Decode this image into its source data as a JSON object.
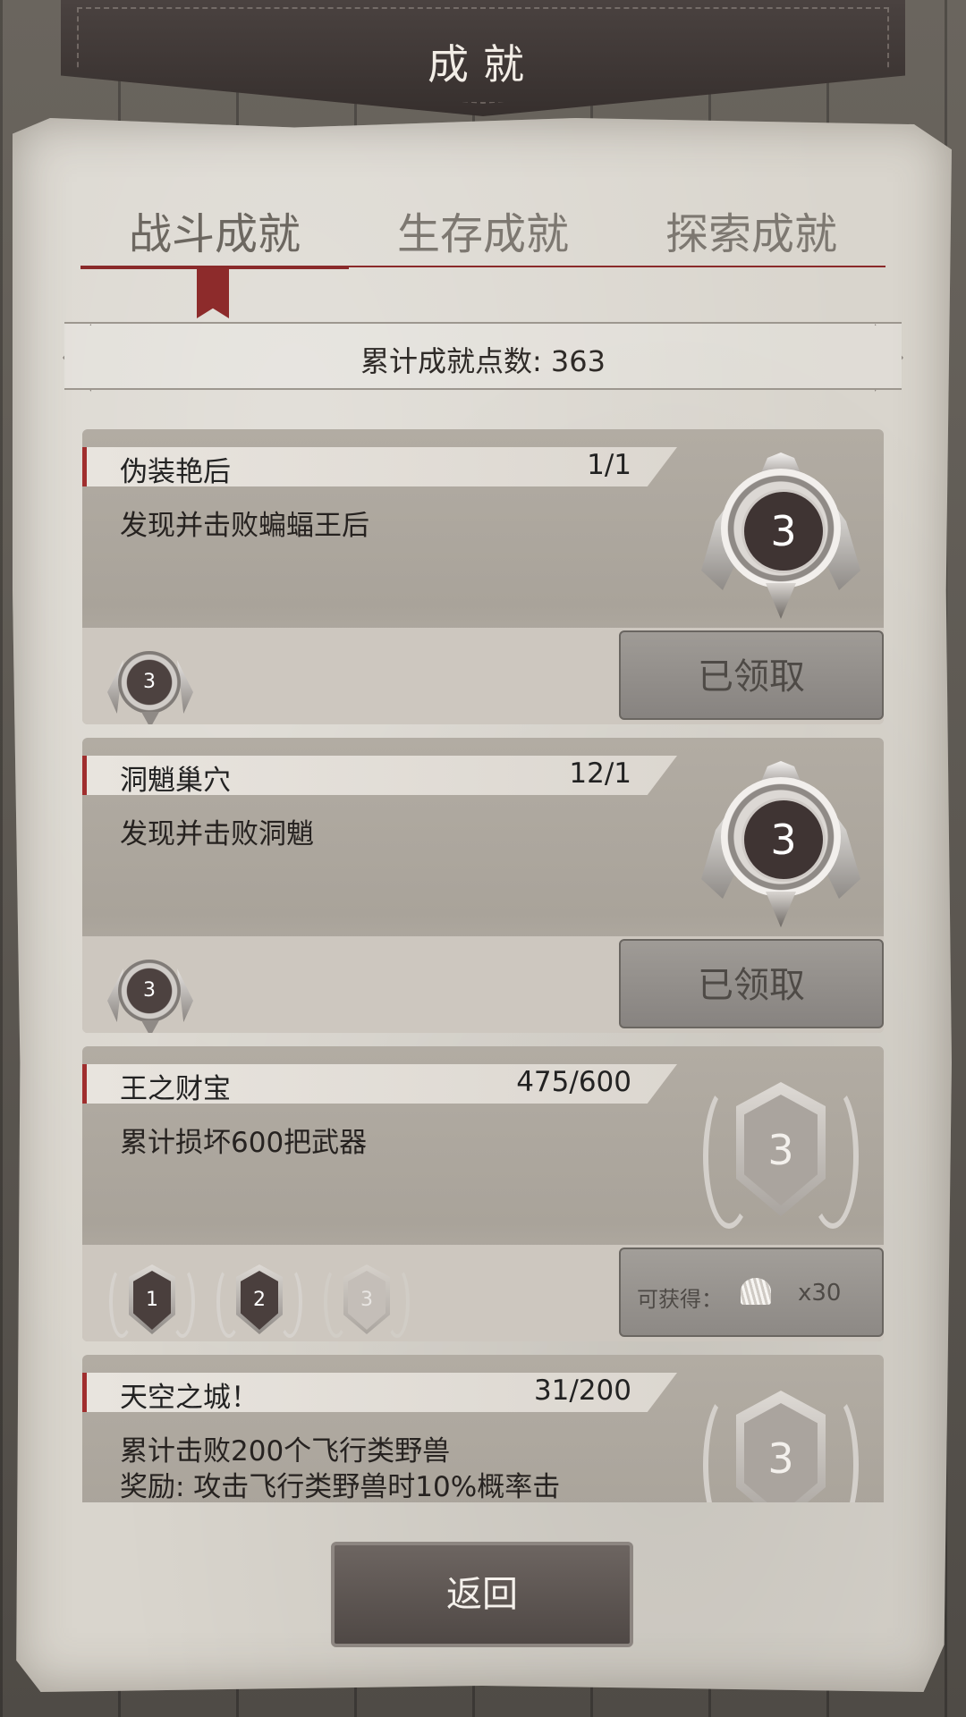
{
  "header": {
    "title": "成就"
  },
  "tabs": [
    {
      "label": "战斗成就",
      "active": true
    },
    {
      "label": "生存成就",
      "active": false
    },
    {
      "label": "探索成就",
      "active": false
    }
  ],
  "points_label": "累计成就点数: 363",
  "achievements": [
    {
      "name": "伪装艳后",
      "progress": "1/1",
      "desc": "发现并击败蝙蝠王后",
      "medal": "3",
      "tiers": [
        "3"
      ],
      "button": "已领取"
    },
    {
      "name": "洞魈巢穴",
      "progress": "12/1",
      "desc": "发现并击败洞魈",
      "medal": "3",
      "tiers": [
        "3"
      ],
      "button": "已领取"
    },
    {
      "name": "王之财宝",
      "progress": "475/600",
      "desc": "累计损坏600把武器",
      "medal": "3",
      "tiers": [
        "1",
        "2",
        "3"
      ],
      "reward_label": "可获得：",
      "reward_icon": "shell-icon",
      "reward_qty": "x30"
    },
    {
      "name": "天空之城！",
      "progress": "31/200",
      "desc_line1": "累计击败200个飞行类野兽",
      "desc_line2": "奖励: 攻击飞行类野兽时10%概率击",
      "medal": "3"
    }
  ],
  "back_label": "返回",
  "colors": {
    "accent": "#8a2a2a",
    "paper": "#d9d5cd",
    "leather": "#3e3634"
  }
}
